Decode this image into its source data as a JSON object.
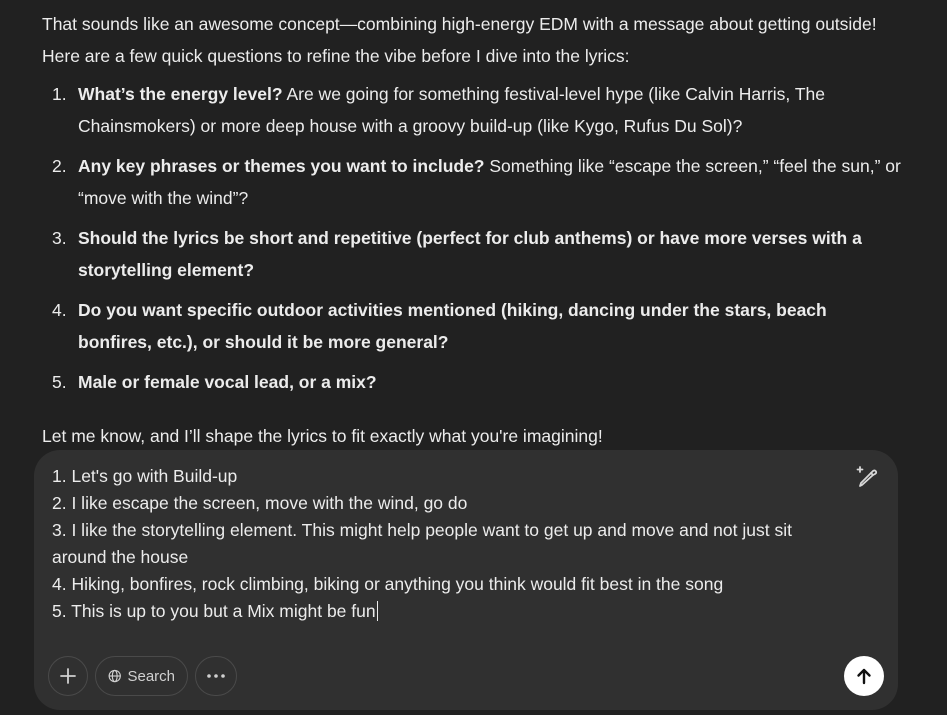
{
  "assistant": {
    "intro": "That sounds like an awesome concept—combining high-energy EDM with a message about getting outside! Here are a few quick questions to refine the vibe before I dive into the lyrics:",
    "questions": [
      {
        "num": "1.",
        "bold": "What’s the energy level?",
        "rest": " Are we going for something festival-level hype (like Calvin Harris, The Chainsmokers) or more deep house with a groovy build-up (like Kygo, Rufus Du Sol)?"
      },
      {
        "num": "2.",
        "bold": "Any key phrases or themes you want to include?",
        "rest": " Something like “escape the screen,” “feel the sun,” or “move with the wind”?"
      },
      {
        "num": "3.",
        "bold": "Should the lyrics be short and repetitive (perfect for club anthems) or have more verses with a storytelling element?",
        "rest": ""
      },
      {
        "num": "4.",
        "bold": "Do you want specific outdoor activities mentioned (hiking, dancing under the stars, beach bonfires, etc.), or should it be more general?",
        "rest": ""
      },
      {
        "num": "5.",
        "bold": "Male or female vocal lead, or a mix?",
        "rest": ""
      }
    ],
    "outro": "Let me know, and I’ll shape the lyrics to fit exactly what you're imagining!"
  },
  "composer": {
    "lines": [
      "1. Let's go with Build-up",
      "2. I like escape the screen, move with the wind, go do",
      "3. I like the storytelling element. This might help people want to get up and move and not just sit around the house",
      "4. Hiking, bonfires, rock climbing, biking or anything you think would fit best in the song",
      "5. This is up to you but a Mix might be fun"
    ],
    "search_label": "Search"
  },
  "icons": {
    "edit": "pencil-sparkle-icon",
    "plus": "plus-icon",
    "globe": "globe-icon",
    "more": "ellipsis-icon",
    "send": "arrow-up-icon"
  },
  "colors": {
    "background": "#212121",
    "composer": "#303030",
    "text": "#ececec",
    "send_button": "#ffffff"
  }
}
